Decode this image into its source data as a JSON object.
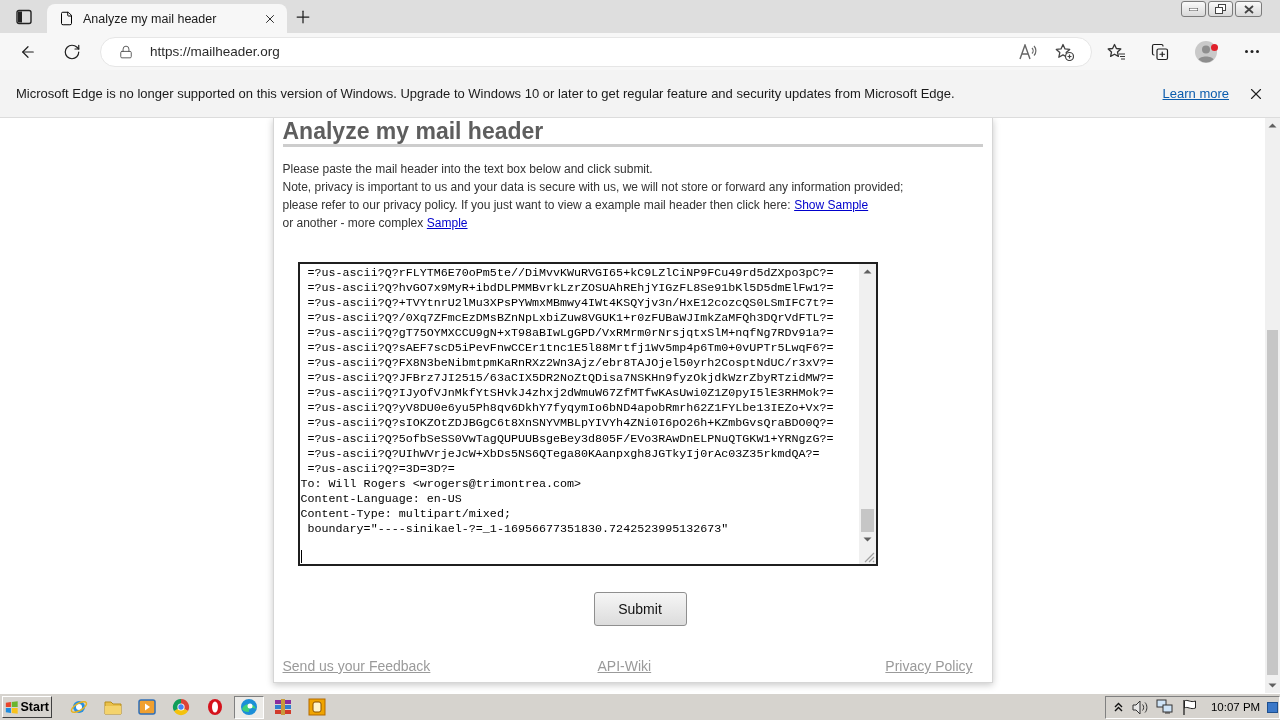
{
  "browser": {
    "tabs": [
      {
        "title": "Analyze my mail header",
        "selected": true
      }
    ],
    "address": "https://mailheader.org"
  },
  "banner": {
    "message": "Microsoft Edge is no longer supported on this version of Windows. Upgrade to Windows 10 or later to get regular feature and security updates from Microsoft Edge.",
    "link": "Learn more"
  },
  "page": {
    "heading": "Analyze my mail header",
    "instructions": [
      {
        "text": "Please paste the mail header into the text box below and click submit."
      },
      {
        "text": "Note, privacy is important to us and your data is secure with us, we will not store or forward any information provided;"
      },
      {
        "text": "please refer to our privacy policy. If you just want to view a example mail header then click here:",
        "link": "Show Sample"
      },
      {
        "text": "or another - more complex",
        "link": "Sample"
      }
    ],
    "header_field": {
      "lines": [
        " =?us-ascii?Q?rFLYTM6E70oPm5te//DiMvvKWuRVGI65+kC9LZlCiNP9FCu49rd5dZXpo3pC?=",
        " =?us-ascii?Q?hvGO7x9MyR+ibdDLPMMBvrkLzrZOSUAhREhjYIGzFL8Se91bKl5D5dmElFw1?=",
        " =?us-ascii?Q?+TVYtnrU2lMu3XPsPYWmxMBmwy4IWt4KSQYjv3n/HxE12cozcQS0LSmIFC7t?=",
        " =?us-ascii?Q?/0Xq7ZFmcEzDMsBZnNpLxbiZuw8VGUK1+r0zFUBaWJImkZaMFQh3DQrVdFTL?=",
        " =?us-ascii?Q?gT75OYMXCCU9gN+xT98aBIwLgGPD/VxRMrm0rNrsjqtxSlM+nqfNg7RDv91a?=",
        " =?us-ascii?Q?sAEF7scD5iPevFnwCCEr1tnc1E5l88Mrtfj1Wv5mp4p6Tm0+0vUPTr5LwqF6?=",
        " =?us-ascii?Q?FX8N3beNibmtpmKaRnRXz2Wn3Ajz/ebr8TAJOjel50yrh2CosptNdUC/r3xV?=",
        " =?us-ascii?Q?JFBrz7JI2515/63aCIX5DR2NoZtQDisa7NSKHn9fyzOkjdkWzrZbyRTzidMW?=",
        " =?us-ascii?Q?IJyOfVJnMkfYtSHvkJ4zhxj2dWmuW67ZfMTfwKAsUwi0Z1Z0pyI5lE3RHMok?=",
        " =?us-ascii?Q?yV8DU0e6yu5Ph8qv6DkhY7fyqymIo6bND4apobRmrh62Z1FYLbe13IEZo+Vx?=",
        " =?us-ascii?Q?sIOKZOtZDJBGgC6t8XnSNYVMBLpYIVYh4ZNi0I6pO26h+KZmbGvsQraBDO0Q?=",
        " =?us-ascii?Q?5ofbSeSS0VwTagQUPUUBsgeBey3d805F/EVo3RAwDnELPNuQTGKW1+YRNgzG?=",
        " =?us-ascii?Q?UIhWVrjeJcW+XbDs5NS6QTega80KAanpxgh8JGTkyIj0rAc03Z35rkmdQA?=",
        " =?us-ascii?Q?=3D=3D?=",
        "To: Will Rogers <wrogers@trimontrea.com>",
        "Content-Language: en-US",
        "Content-Type: multipart/mixed;",
        " boundary=\"----sinikael-?=_1-16956677351830.7242523995132673\""
      ]
    },
    "submit": "Submit",
    "footer_links": [
      "Send us your Feedback",
      "API-Wiki",
      "Privacy Policy"
    ]
  },
  "taskbar": {
    "start": "Start",
    "apps": [
      {
        "kind": "globe",
        "selected": false
      },
      {
        "kind": "folder",
        "selected": false
      },
      {
        "kind": "player",
        "selected": false
      },
      {
        "kind": "wheel",
        "selected": false
      },
      {
        "kind": "ring",
        "selected": false
      },
      {
        "kind": "swirl",
        "selected": true
      },
      {
        "kind": "books",
        "selected": false
      },
      {
        "kind": "tile",
        "selected": false
      }
    ],
    "clock": "10:07 PM"
  }
}
